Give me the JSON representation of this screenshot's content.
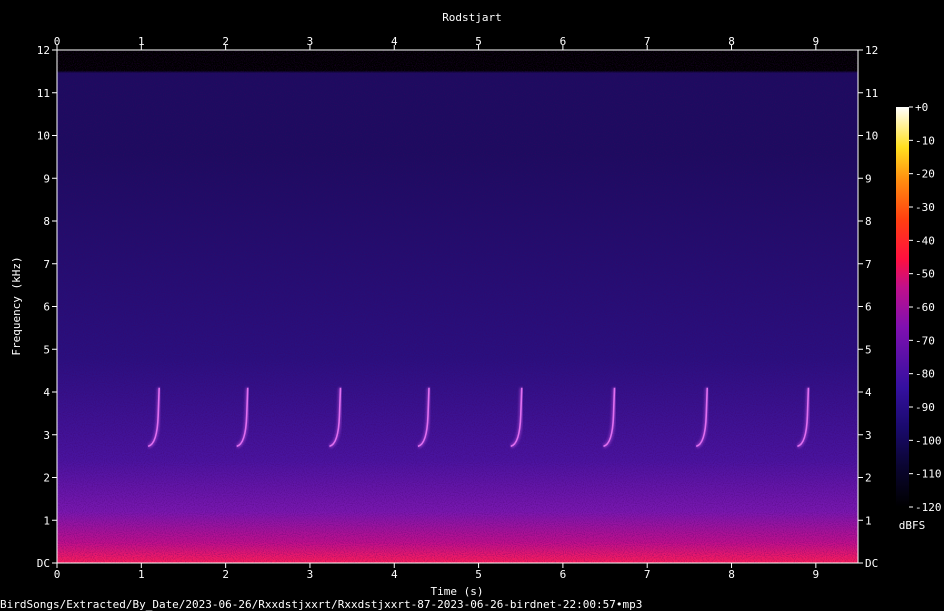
{
  "chart_data": {
    "type": "heatmap",
    "title": "Rodstjart",
    "xlabel": "Time (s)",
    "ylabel": "Frequency (kHz)",
    "xlim": [
      0,
      9.5
    ],
    "ylim": [
      0,
      12
    ],
    "x_ticks": [
      "0",
      "1",
      "2",
      "3",
      "4",
      "5",
      "6",
      "7",
      "8",
      "9"
    ],
    "y_ticks": [
      "DC",
      "1",
      "2",
      "3",
      "4",
      "5",
      "6",
      "7",
      "8",
      "9",
      "10",
      "11",
      "12"
    ],
    "colorbar": {
      "label": "dBFS",
      "ticks": [
        "+0",
        "-10",
        "-20",
        "-30",
        "-40",
        "-50",
        "-60",
        "-70",
        "-80",
        "-90",
        "-100",
        "-110",
        "-120"
      ],
      "range": [
        -120,
        0
      ]
    },
    "energy_ceiling_khz": 11.5,
    "calls": [
      {
        "t": 1.2,
        "f_low": 2.8,
        "f_high": 4.1
      },
      {
        "t": 2.25,
        "f_low": 2.8,
        "f_high": 4.1
      },
      {
        "t": 3.35,
        "f_low": 2.8,
        "f_high": 4.1
      },
      {
        "t": 4.4,
        "f_low": 2.8,
        "f_high": 4.1
      },
      {
        "t": 5.5,
        "f_low": 2.8,
        "f_high": 4.1
      },
      {
        "t": 6.6,
        "f_low": 2.8,
        "f_high": 4.1
      },
      {
        "t": 7.7,
        "f_low": 2.8,
        "f_high": 4.1
      },
      {
        "t": 8.9,
        "f_low": 2.8,
        "f_high": 4.1
      }
    ],
    "grid": false
  },
  "footer": {
    "file_path": "BirdSongs/Extracted/By_Date/2023-06-26/Rxxdstjxxrt/Rxxdstjxxrt-87-2023-06-26-birdnet-22:00:57•mp3"
  },
  "colors": {
    "background": "#000000",
    "low_energy": "#1a0a5e",
    "mid_energy": "#6a1fb0",
    "high_energy": "#ff1e3c",
    "peak": "#ffffff"
  }
}
